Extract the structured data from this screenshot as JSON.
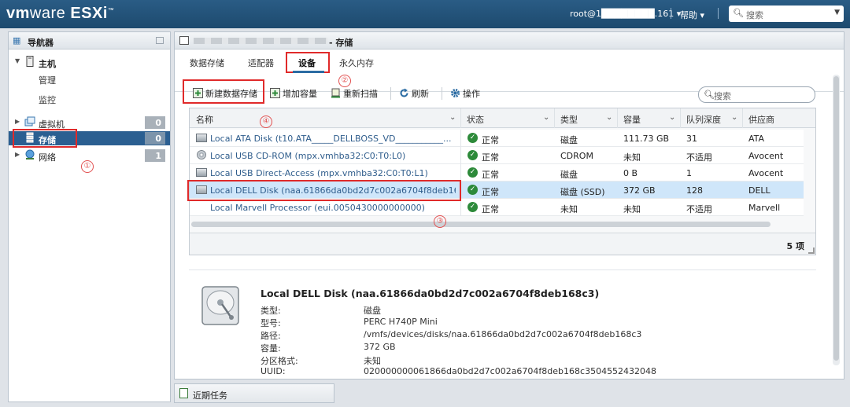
{
  "header": {
    "brand_vm": "vm",
    "brand_ware": "ware",
    "brand_product": " ESXi",
    "brand_tm": "™",
    "user": "root@1████████.161 ▾",
    "help": "帮助 ▾",
    "search_placeholder": "搜索"
  },
  "navigator": {
    "title": "导航器",
    "host_label": "主机",
    "host_children": [
      "管理",
      "监控"
    ],
    "items": [
      {
        "label": "虚拟机",
        "count": "0"
      },
      {
        "label": "存储",
        "count": "0",
        "selected": true
      },
      {
        "label": "网络",
        "count": "1"
      }
    ]
  },
  "main": {
    "title_suffix": "- 存储",
    "tabs": [
      "数据存储",
      "适配器",
      "设备",
      "永久内存"
    ],
    "active_tab": "设备",
    "toolbar": {
      "new_datastore": "新建数据存储",
      "increase_capacity": "增加容量",
      "rescan": "重新扫描",
      "refresh": "刷新",
      "actions": "操作"
    },
    "search_placeholder": "搜索",
    "columns": [
      "名称",
      "状态",
      "类型",
      "容量",
      "队列深度",
      "供应商"
    ],
    "rows": [
      {
        "icon": "disk-icon",
        "name": "Local ATA Disk (t10.ATA_____DELLBOSS_VD___________...",
        "status": "正常",
        "type": "磁盘",
        "capacity": "111.73 GB",
        "queue": "31",
        "vendor": "ATA"
      },
      {
        "icon": "cdrom-icon",
        "name": "Local USB CD-ROM (mpx.vmhba32:C0:T0:L0)",
        "status": "正常",
        "type": "CDROM",
        "capacity": "未知",
        "queue": "不适用",
        "vendor": "Avocent"
      },
      {
        "icon": "disk-icon",
        "name": "Local USB Direct-Access (mpx.vmhba32:C0:T0:L1)",
        "status": "正常",
        "type": "磁盘",
        "capacity": "0 B",
        "queue": "1",
        "vendor": "Avocent"
      },
      {
        "icon": "disk-icon",
        "name": "Local DELL Disk (naa.61866da0bd2d7c002a6704f8deb168c3)",
        "status": "正常",
        "type": "磁盘 (SSD)",
        "capacity": "372 GB",
        "queue": "128",
        "vendor": "DELL",
        "selected": true
      },
      {
        "icon": "",
        "name": "Local Marvell Processor (eui.0050430000000000)",
        "status": "正常",
        "type": "未知",
        "capacity": "未知",
        "queue": "不适用",
        "vendor": "Marvell"
      }
    ],
    "item_count": "5 项",
    "detail": {
      "title": "Local DELL Disk (naa.61866da0bd2d7c002a6704f8deb168c3)",
      "fields": [
        {
          "label": "类型:",
          "value": "磁盘"
        },
        {
          "label": "型号:",
          "value": "PERC H740P Mini"
        },
        {
          "label": "路径:",
          "value": "/vmfs/devices/disks/naa.61866da0bd2d7c002a6704f8deb168c3"
        },
        {
          "label": "容量:",
          "value": "372 GB"
        },
        {
          "label": "分区格式:",
          "value": "未知"
        },
        {
          "label": "UUID:",
          "value": "020000000061866da0bd2d7c002a6704f8deb168c3504552432048"
        }
      ]
    }
  },
  "recent_tasks": "近期任务",
  "annotations": [
    "①",
    "②",
    "③",
    "④"
  ],
  "colors": {
    "accent": "#2b5f91",
    "highlight": "#e02a2a",
    "ok": "#2d8a3a",
    "selected_row": "#cfe6fa"
  }
}
